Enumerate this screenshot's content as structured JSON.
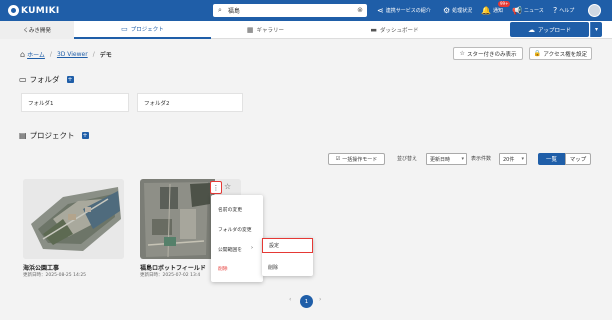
{
  "app": {
    "logo": "KUMIKI"
  },
  "search": {
    "value": "福島"
  },
  "topnav": {
    "integration": "連携サービスの紹介",
    "processing": "処理状況",
    "notifications": "通知",
    "notifications_badge": "99+",
    "news": "ニュース",
    "help": "ヘルプ"
  },
  "subnav": {
    "home": "くみき開発",
    "project": "プロジェクト",
    "gallery": "ギャラリー",
    "dashboard": "ダッシュボード",
    "upload": "アップロード"
  },
  "breadcrumb": {
    "home": "ホーム",
    "viewer": "3D Viewer",
    "current": "デモ"
  },
  "actions": {
    "starred_only": "スター付きのみ表示",
    "set_access": "アクセス権を設定"
  },
  "folders": {
    "title": "フォルダ",
    "items": [
      "フォルダ1",
      "フォルダ2"
    ]
  },
  "projects": {
    "title": "プロジェクト",
    "bulk_mode": "一括操作モード",
    "sort_label": "並び替え",
    "sort_value": "更新日時",
    "per_page_label": "表示件数",
    "per_page_value": "20件",
    "view_list": "一覧",
    "view_map": "マップ",
    "cards": [
      {
        "name": "海浜公園工事",
        "date": "更新日時：2025-08-25 14:25"
      },
      {
        "name": "福島ロボットフィールド",
        "date": "更新日時：2025-07-02 13:4"
      }
    ]
  },
  "context_menu": {
    "items": [
      "名前の変更",
      "フォルダの変更",
      "公開範囲を",
      "削除"
    ],
    "submenu": [
      "設定",
      "削除"
    ]
  },
  "pagination": {
    "prev": "‹",
    "current": "1",
    "next": "›"
  },
  "colors": {
    "primary": "#1f5ea8",
    "highlight": "#e53935",
    "background": "#f3f3f3"
  }
}
